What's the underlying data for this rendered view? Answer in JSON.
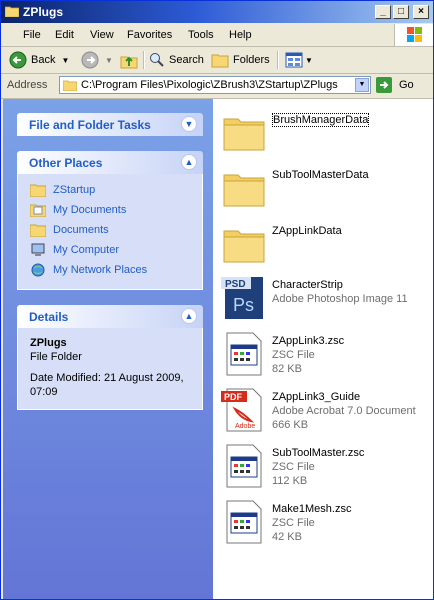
{
  "window": {
    "title": "ZPlugs"
  },
  "menu": [
    "File",
    "Edit",
    "View",
    "Favorites",
    "Tools",
    "Help"
  ],
  "toolbar": {
    "back": "Back",
    "search": "Search",
    "folders": "Folders"
  },
  "address": {
    "label": "Address",
    "value": "C:\\Program Files\\Pixologic\\ZBrush3\\ZStartup\\ZPlugs",
    "go": "Go"
  },
  "tasks": {
    "file_folder_title": "File and Folder Tasks",
    "other_places_title": "Other Places",
    "other_places": [
      "ZStartup",
      "My Documents",
      "Documents",
      "My Computer",
      "My Network Places"
    ],
    "details_title": "Details",
    "details_name": "ZPlugs",
    "details_type": "File Folder",
    "details_modified_1": "Date Modified: 21 August 2009,",
    "details_modified_2": "07:09"
  },
  "files": [
    {
      "name": "BrushManagerData",
      "line1": "",
      "line2": "",
      "icon": "folder-icon"
    },
    {
      "name": "SubToolMasterData",
      "line1": "",
      "line2": "",
      "icon": "folder-icon"
    },
    {
      "name": "ZAppLinkData",
      "line1": "",
      "line2": "",
      "icon": "folder-icon"
    },
    {
      "name": "CharacterStrip",
      "line1": "Adobe Photoshop Image 11",
      "line2": "",
      "icon": "psd-icon"
    },
    {
      "name": "ZAppLink3.zsc",
      "line1": "ZSC File",
      "line2": "82 KB",
      "icon": "zsc-icon"
    },
    {
      "name": "ZAppLink3_Guide",
      "line1": "Adobe Acrobat 7.0 Document",
      "line2": "666 KB",
      "icon": "pdf-icon"
    },
    {
      "name": "SubToolMaster.zsc",
      "line1": "ZSC File",
      "line2": "112 KB",
      "icon": "zsc-icon"
    },
    {
      "name": "Make1Mesh.zsc",
      "line1": "ZSC File",
      "line2": "42 KB",
      "icon": "zsc-icon"
    }
  ],
  "icon_labels": {
    "psd_badge": "PSD",
    "psd_glyph": "Ps",
    "pdf_badge": "PDF",
    "pdf_brand": "Adobe"
  }
}
